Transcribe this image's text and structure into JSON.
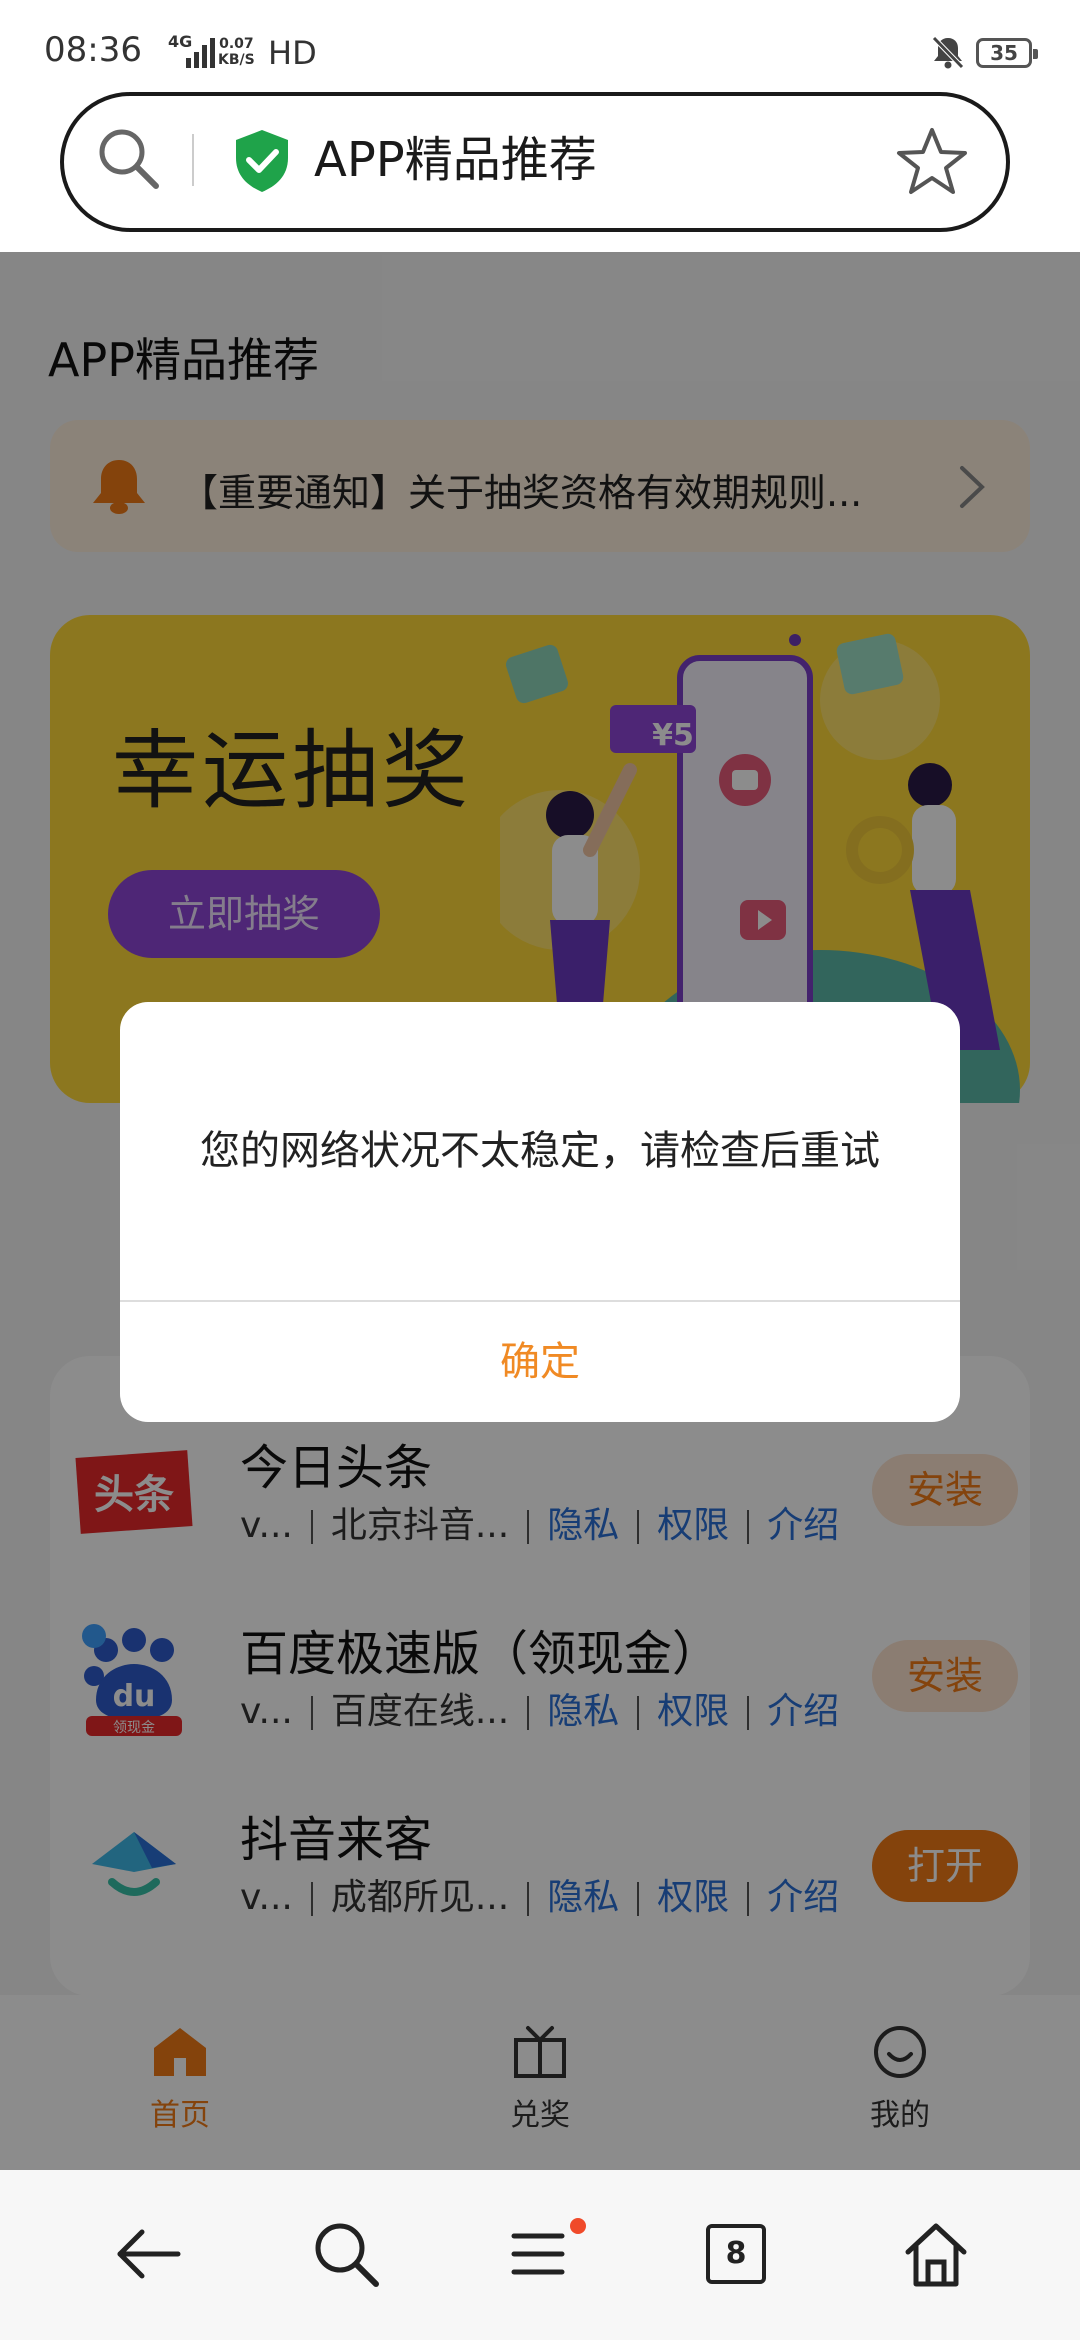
{
  "status_bar": {
    "time": "08:36",
    "network": "4G",
    "speed_value": "0.07",
    "speed_unit": "KB/S",
    "hd": "HD",
    "battery": "35"
  },
  "address_bar": {
    "title": "APP精品推荐"
  },
  "page": {
    "title": "APP精品推荐",
    "notice": "【重要通知】关于抽奖资格有效期规则..."
  },
  "banner": {
    "title": "幸运抽奖",
    "button": "立即抽奖",
    "coupon": "¥5"
  },
  "apps": [
    {
      "name": "今日头条",
      "version": "v...",
      "developer": "北京抖音...",
      "privacy": "隐私",
      "permissions": "权限",
      "intro": "介绍",
      "action": "安装",
      "icon": "toutiao-logo"
    },
    {
      "name": "百度极速版（领现金）",
      "version": "v...",
      "developer": "百度在线...",
      "privacy": "隐私",
      "permissions": "权限",
      "intro": "介绍",
      "action": "安装",
      "icon": "baidu-paw-logo"
    },
    {
      "name": "抖音来客",
      "version": "v...",
      "developer": "成都所见...",
      "privacy": "隐私",
      "permissions": "权限",
      "intro": "介绍",
      "action": "打开",
      "icon": "douyin-laike-logo"
    }
  ],
  "app_nav": {
    "home": "首页",
    "redeem": "兑奖",
    "mine": "我的"
  },
  "dialog": {
    "message": "您的网络状况不太稳定，请检查后重试",
    "confirm": "确定"
  },
  "toolbar": {
    "tabs_count": "8"
  },
  "colors": {
    "accent": "#f08a24",
    "link": "#2a6fd6",
    "banner": "#ffd93a",
    "banner_button": "#8e46d8"
  }
}
